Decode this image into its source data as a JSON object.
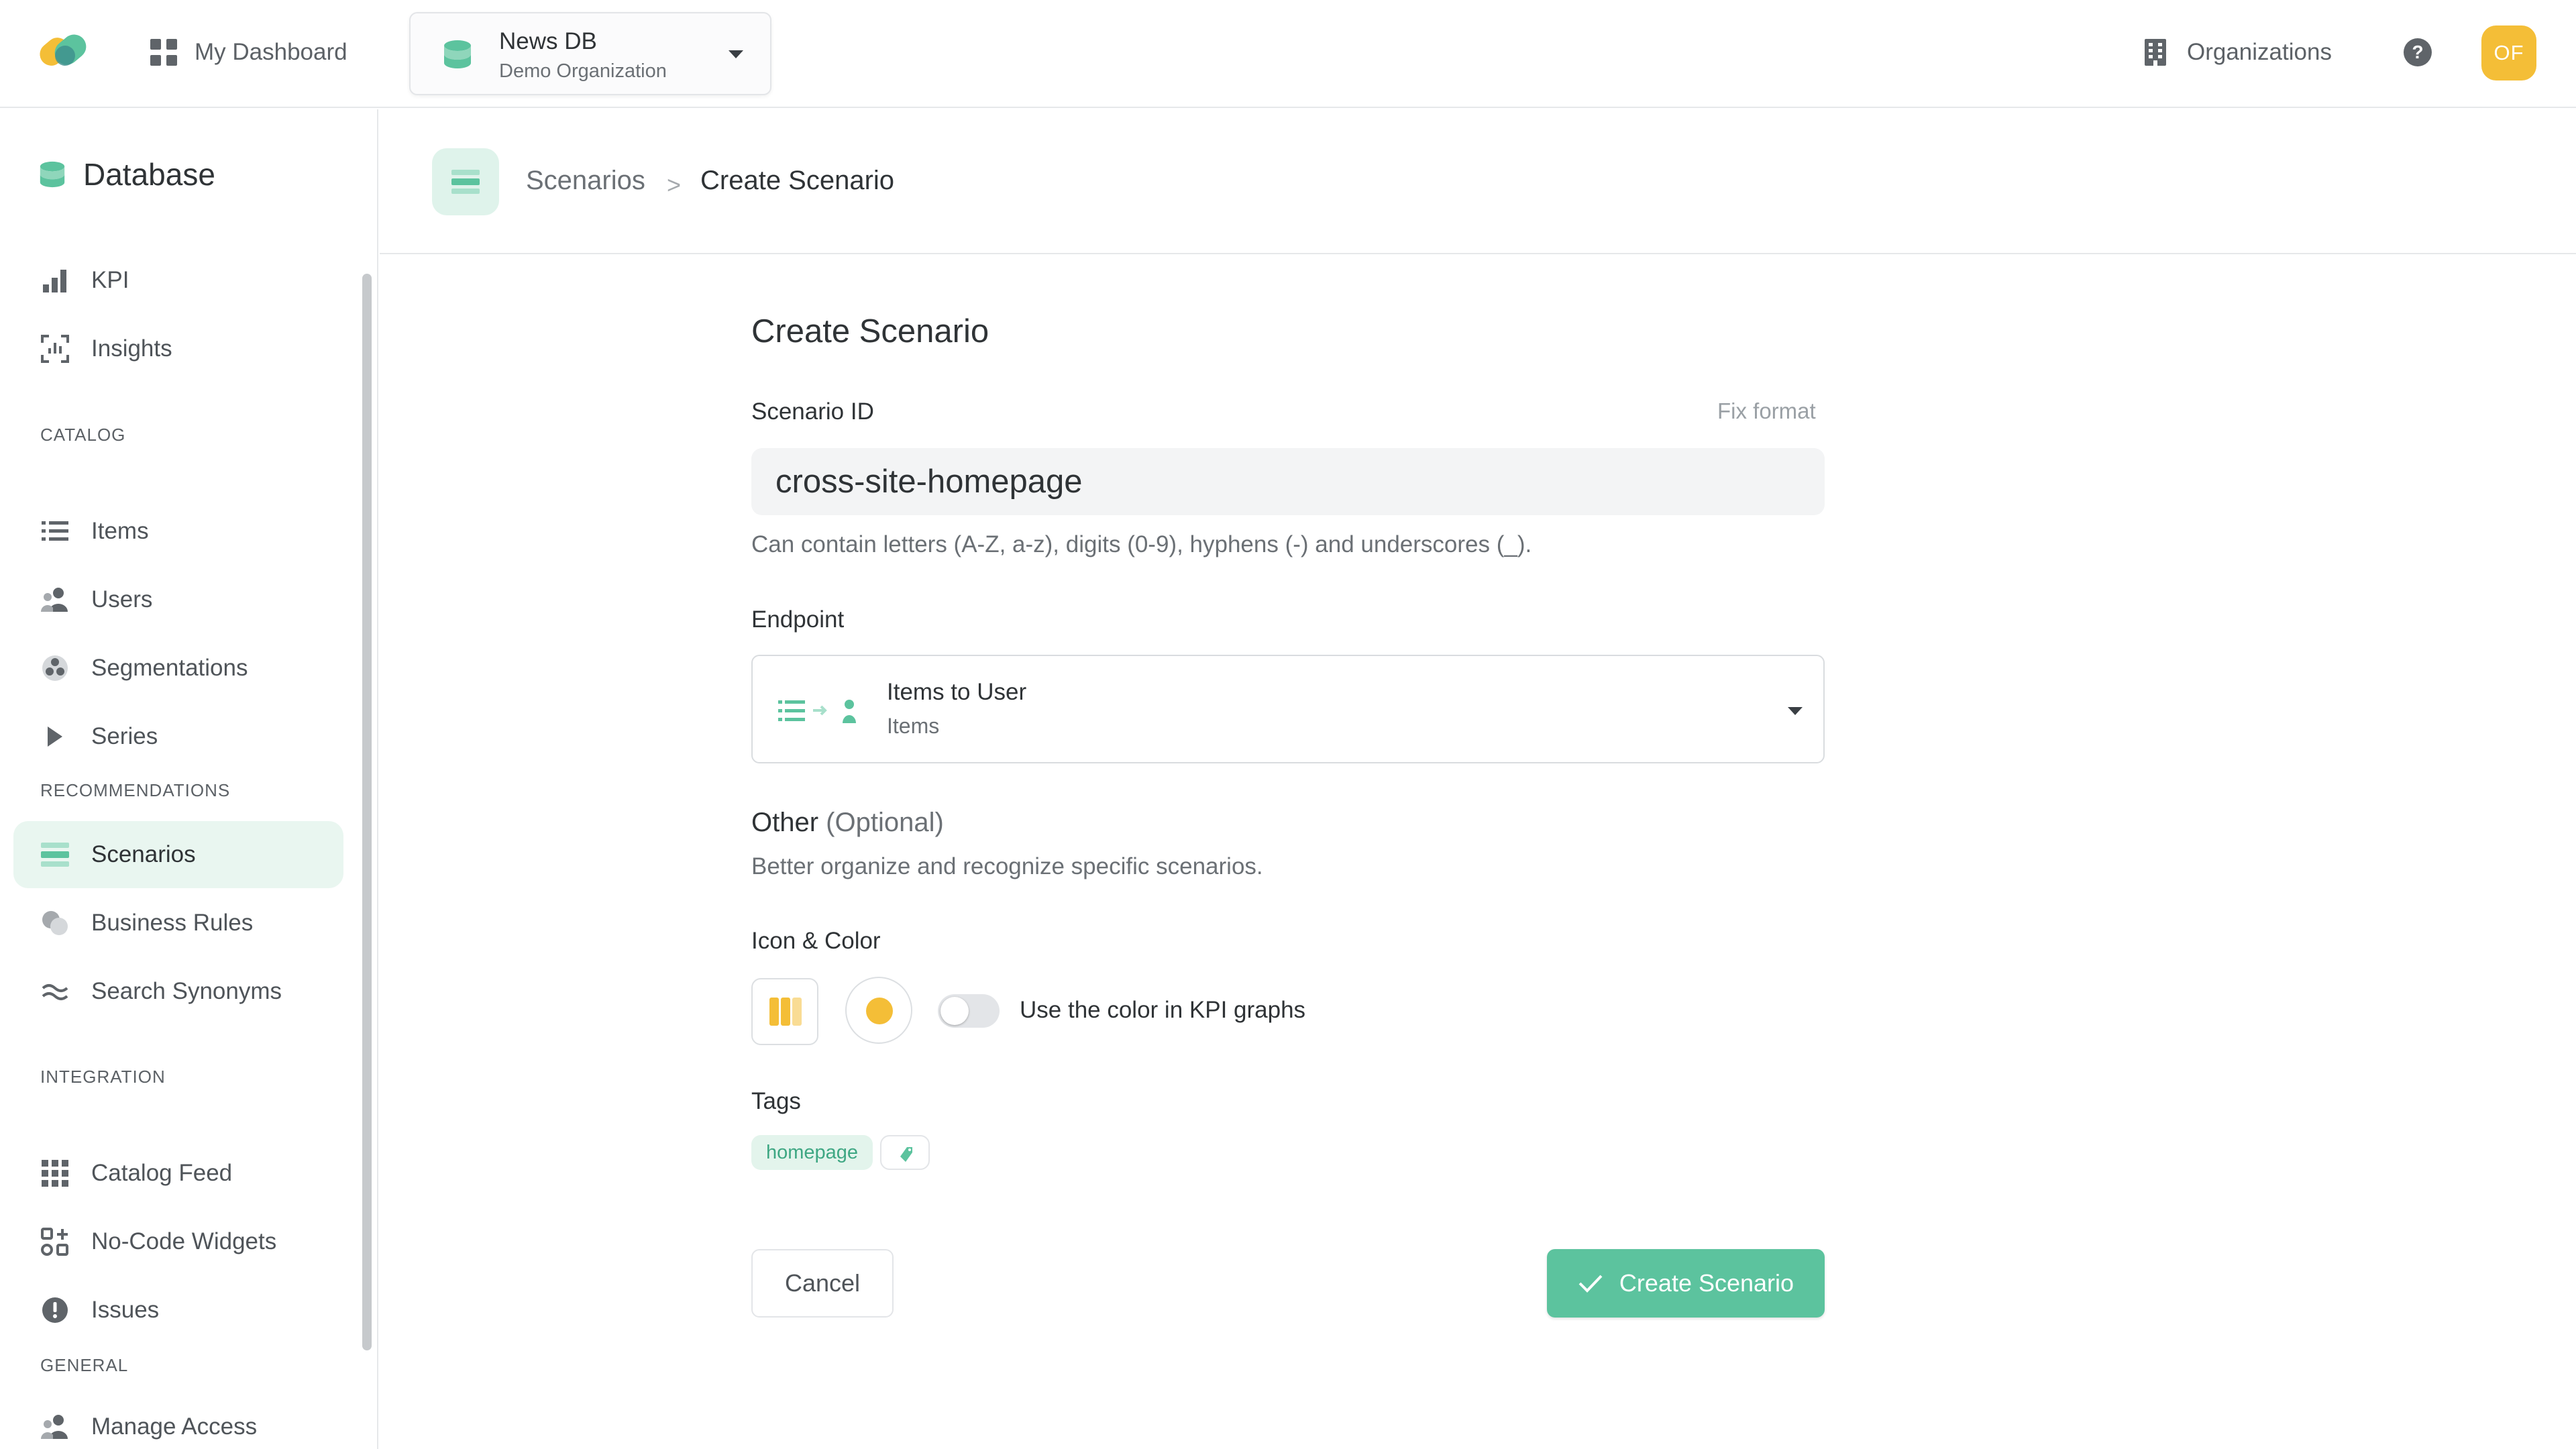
{
  "header": {
    "dashboard_label": "My Dashboard",
    "database": {
      "name": "News DB",
      "organization": "Demo Organization"
    },
    "organizations_label": "Organizations",
    "help_label": "?",
    "avatar_initials": "OF"
  },
  "sidebar": {
    "title": "Database",
    "top_items": [
      {
        "label": "KPI",
        "icon": "bar-chart-icon"
      },
      {
        "label": "Insights",
        "icon": "insights-icon"
      }
    ],
    "sections": {
      "catalog": "CATALOG",
      "recommendations": "RECOMMENDATIONS",
      "integration": "INTEGRATION",
      "general": "GENERAL"
    },
    "catalog_items": [
      {
        "label": "Items",
        "icon": "list-icon"
      },
      {
        "label": "Users",
        "icon": "users-icon"
      },
      {
        "label": "Segmentations",
        "icon": "segmentations-icon"
      },
      {
        "label": "Series",
        "icon": "play-icon"
      }
    ],
    "recommendation_items": [
      {
        "label": "Scenarios",
        "icon": "scenarios-icon",
        "active": true
      },
      {
        "label": "Business Rules",
        "icon": "business-rules-icon"
      },
      {
        "label": "Search Synonyms",
        "icon": "synonyms-icon"
      }
    ],
    "integration_items": [
      {
        "label": "Catalog Feed",
        "icon": "grid-icon"
      },
      {
        "label": "No-Code Widgets",
        "icon": "widgets-icon"
      },
      {
        "label": "Issues",
        "icon": "alert-icon"
      }
    ],
    "general_items": [
      {
        "label": "Manage Access",
        "icon": "users-icon"
      }
    ]
  },
  "breadcrumb": {
    "parent": "Scenarios",
    "separator": ">",
    "current": "Create Scenario"
  },
  "form": {
    "title": "Create Scenario",
    "scenario_id": {
      "label": "Scenario ID",
      "fix_format": "Fix format",
      "value": "cross-site-homepage",
      "help": "Can contain letters (A-Z, a-z), digits (0-9), hyphens (-) and underscores (_)."
    },
    "endpoint": {
      "label": "Endpoint",
      "name": "Items to User",
      "sub": "Items"
    },
    "other": {
      "title": "Other",
      "optional": "(Optional)",
      "description": "Better organize and recognize specific scenarios."
    },
    "icon_color": {
      "label": "Icon & Color",
      "toggle_label": "Use the color in KPI graphs",
      "toggle_on": false,
      "color": "#f4be37"
    },
    "tags": {
      "label": "Tags",
      "items": [
        "homepage"
      ]
    },
    "cancel_label": "Cancel",
    "create_label": "Create Scenario"
  },
  "colors": {
    "accent": "#5cc39e",
    "accent_light": "#e9f6f0",
    "avatar": "#f4be37"
  }
}
